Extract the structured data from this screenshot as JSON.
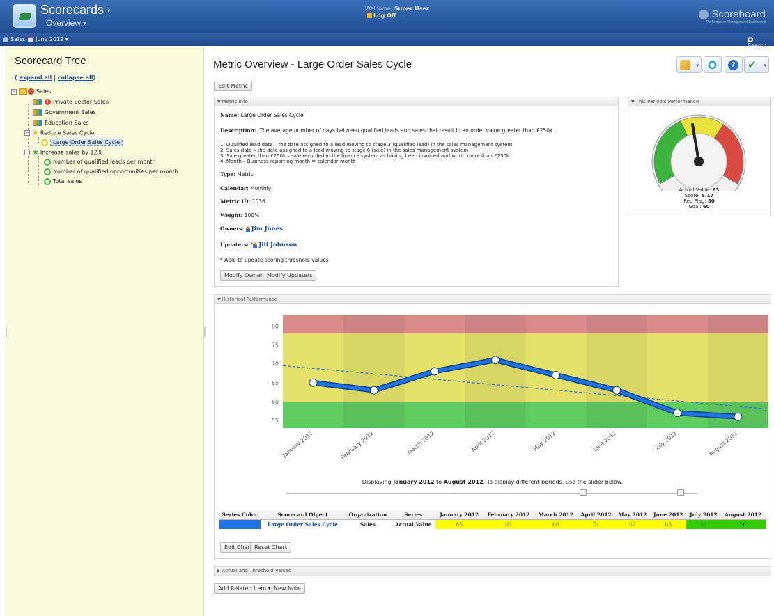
{
  "header": {
    "app_title": "Scorecards",
    "app_subtitle": "Overview",
    "welcome_prefix": "Welcome,",
    "welcome_user": "Super User",
    "logoff": "Log Off",
    "brand": "Scoreboard",
    "brand_tag": "Performance Management Dashboard"
  },
  "subbar": {
    "context": "Sales",
    "period": "June 2012",
    "search": "Search"
  },
  "tree": {
    "title": "Scorecard Tree",
    "expand_all": "expand all",
    "separator": "|",
    "collapse_all": "collapse all",
    "items": [
      {
        "label": "Sales"
      },
      {
        "label": "Private Sector Sales"
      },
      {
        "label": "Government Sales"
      },
      {
        "label": "Education Sales"
      },
      {
        "label": "Reduce Sales Cycle"
      },
      {
        "label": "Large Order Sales Cycle"
      },
      {
        "label": "Increase sales by 12%"
      },
      {
        "label": "Number of qualified leads per month"
      },
      {
        "label": "Number of qualified opportunities per month"
      },
      {
        "label": "Total sales"
      }
    ]
  },
  "main": {
    "title": "Metric Overview - Large Order Sales Cycle",
    "edit_metric": "Edit Metric"
  },
  "metric_info": {
    "header": "Metric Info",
    "name_label": "Name:",
    "name": "Large Order Sales Cycle",
    "description_label": "Description:",
    "description": "The average number of days between qualified leads and sales that result in an order value greater than £250k",
    "list": [
      "1.   Qualified lead date – the date assigned to a lead moving to stage 3 (qualified lead) in the sales management system",
      "2.   Sales date – the date assigned to a lead moving to stage 6 (sale) in the sales management system",
      "3.   Sale greater than £250k – sale recorded in the finance system as having been invoiced and worth more than £250k",
      "4.   Month – Business reporting month = calendar month"
    ],
    "type_label": "Type:",
    "type": "Metric",
    "calendar_label": "Calendar:",
    "calendar": "Monthly",
    "metric_id_label": "Metric ID:",
    "metric_id": "1036",
    "weight_label": "Weight:",
    "weight": "100%",
    "owners_label": "Owners:",
    "owner": "Jim Jones",
    "updaters_label": "Updaters:",
    "updater_prefix": "*",
    "updater": "Jill Johnson",
    "note": "* Able to update scoring threshold values",
    "modify_owners": "Modify Owners",
    "modify_updaters": "Modify Updaters"
  },
  "performance": {
    "header": "This Period's Performance",
    "actual_label": "Actual Value:",
    "actual": "63",
    "score_label": "Score:",
    "score": "6.17",
    "red_flag_label": "Red Flag:",
    "red_flag": "80",
    "goal_label": "Goal:",
    "goal": "60",
    "needle_value": 63,
    "gauge_range": [
      40,
      90
    ],
    "colors": {
      "green": "#3cb33c",
      "yellow": "#e8e23a",
      "red": "#d94a43"
    }
  },
  "historical": {
    "header": "Historical Performance",
    "display_prefix": "Displaying",
    "display_from": "January 2012",
    "display_to_word": "to",
    "display_to": "August 2012",
    "display_suffix": ". To display different periods, use the slider below.",
    "edit_chart": "Edit Chart",
    "reset_chart": "Reset Chart",
    "table": {
      "headers": [
        "Series Color",
        "Scorecard Object",
        "Organization",
        "Series",
        "January 2012",
        "February 2012",
        "March 2012",
        "April 2012",
        "May 2012",
        "June 2012",
        "July 2012",
        "August 2012"
      ],
      "row": {
        "color": "#1f74e0",
        "object": "Large Order Sales Cycle",
        "organization": "Sales",
        "series": "Actual Value",
        "values": [
          "65",
          "63",
          "68",
          "71",
          "67",
          "63",
          "57",
          "56"
        ]
      }
    }
  },
  "footer": {
    "actual_threshold": "Actual and Threshold Values",
    "add_related": "Add Related Item",
    "new_note": "New Note"
  },
  "chart_data": {
    "type": "line",
    "categories": [
      "January 2012",
      "February 2012",
      "March 2012",
      "April 2012",
      "May 2012",
      "June 2012",
      "July 2012",
      "August 2012"
    ],
    "series": [
      {
        "name": "Actual Value",
        "values": [
          65,
          63,
          68,
          71,
          67,
          63,
          57,
          56
        ],
        "color": "#1f74e0"
      }
    ],
    "trendline": {
      "start": 69.5,
      "end": 58
    },
    "ylim": [
      53,
      83
    ],
    "yticks": [
      55,
      60,
      65,
      70,
      75,
      80
    ],
    "bands": [
      {
        "from": 53,
        "to": 60,
        "color": "#5fcc5f"
      },
      {
        "from": 60,
        "to": 78,
        "color": "#e3e16a"
      },
      {
        "from": 78,
        "to": 83,
        "color": "#d98b8b"
      }
    ],
    "grid": false
  }
}
